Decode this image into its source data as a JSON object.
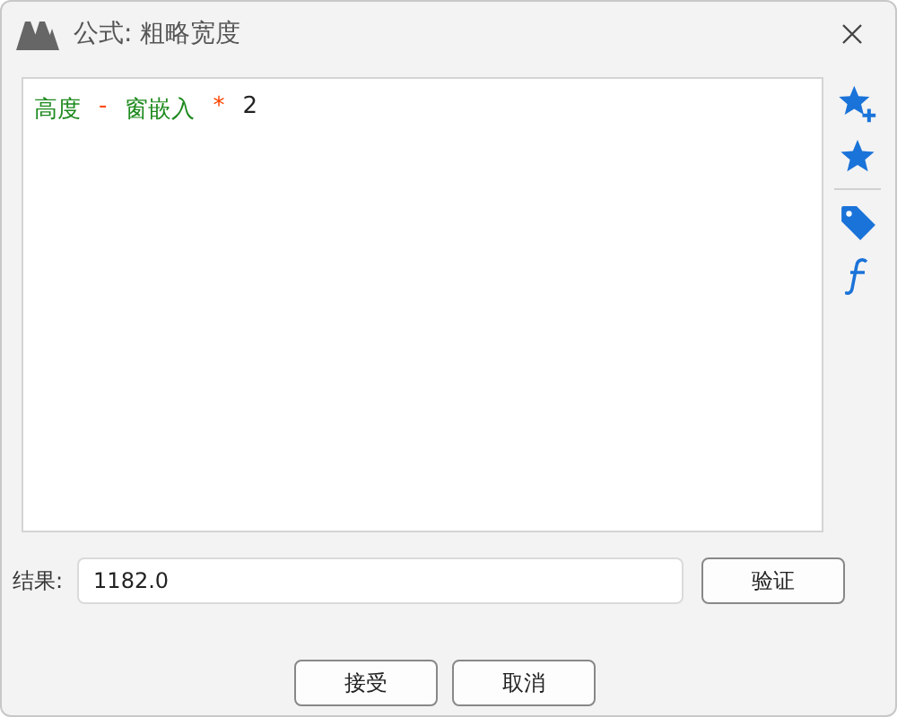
{
  "window": {
    "title": "公式: 粗略宽度"
  },
  "formula": [
    {
      "kind": "field",
      "text": "高度"
    },
    {
      "kind": "operator",
      "text": "-"
    },
    {
      "kind": "field",
      "text": "窗嵌入"
    },
    {
      "kind": "operator",
      "text": "*"
    },
    {
      "kind": "number",
      "text": "2"
    }
  ],
  "result": {
    "label": "结果:",
    "value": "1182.0"
  },
  "validate_button": "验证",
  "buttons": [
    "接受",
    "取消"
  ]
}
